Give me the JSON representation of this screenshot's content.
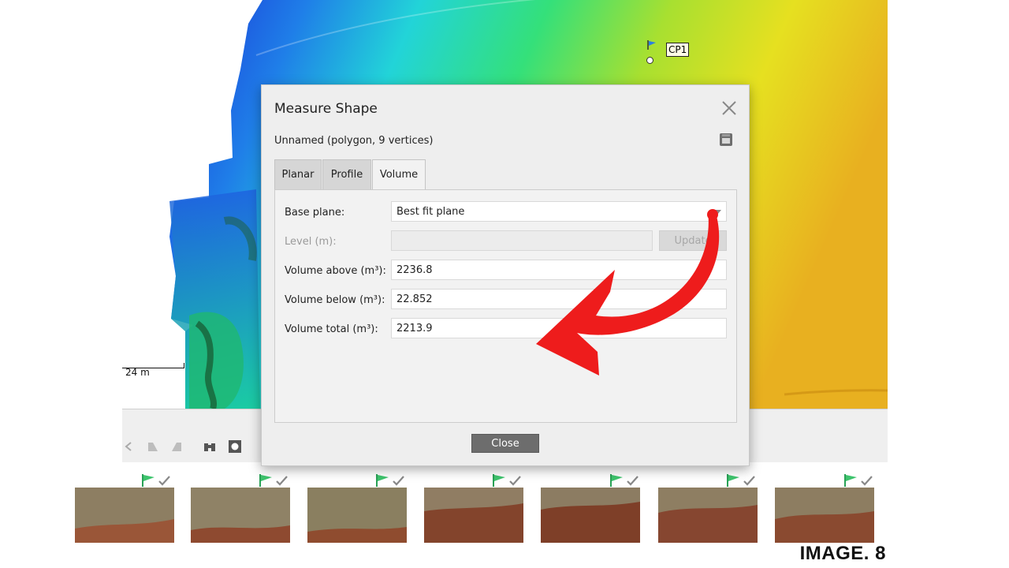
{
  "map": {
    "scale_label": "24 m",
    "control_point_label": "CP1"
  },
  "dialog": {
    "title": "Measure Shape",
    "subtitle": "Unnamed (polygon, 9 vertices)",
    "tabs": [
      {
        "label": "Planar",
        "active": false
      },
      {
        "label": "Profile",
        "active": false
      },
      {
        "label": "Volume",
        "active": true
      }
    ],
    "fields": {
      "base_plane_label": "Base plane:",
      "base_plane_value": "Best fit plane",
      "level_label": "Level (m):",
      "level_value": "",
      "update_label": "Update",
      "volume_above_label": "Volume above (m³):",
      "volume_above_value": "2236.8",
      "volume_below_label": "Volume below (m³):",
      "volume_below_value": "22.852",
      "volume_total_label": "Volume total (m³):",
      "volume_total_value": "2213.9"
    },
    "close_label": "Close"
  },
  "thumbnails": {
    "count": 7,
    "status_icons": [
      "flag-icon",
      "check-icon"
    ]
  },
  "caption": "IMAGE. 8",
  "colors": {
    "arrow_red": "#ee1c1c",
    "dialog_bg": "#eeeeee",
    "close_button": "#6d6d6d",
    "flag_green": "#3ec46d"
  }
}
